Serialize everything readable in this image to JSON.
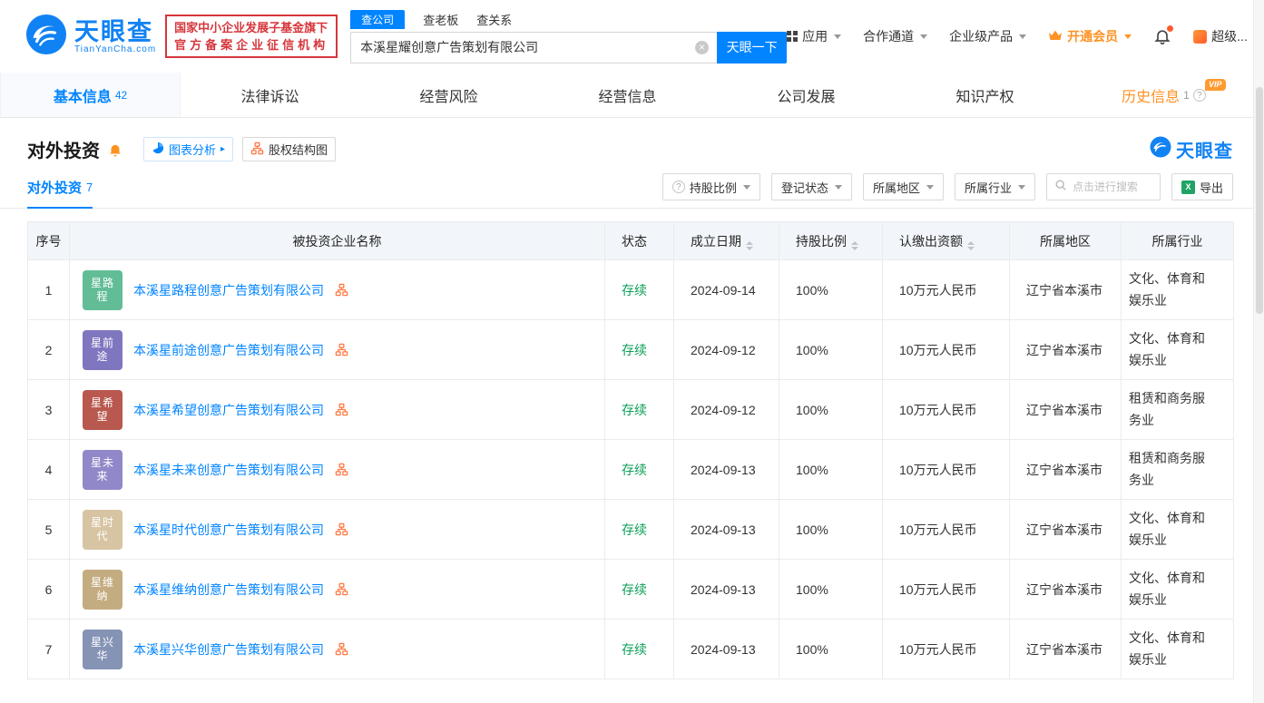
{
  "brand": {
    "name": "天眼查",
    "domain": "TianYanCha.com",
    "slogan_line1": "国家中小企业发展子基金旗下",
    "slogan_line2": "官方备案企业征信机构"
  },
  "search": {
    "tabs": [
      {
        "label": "查公司",
        "active": true
      },
      {
        "label": "查老板",
        "active": false
      },
      {
        "label": "查关系",
        "active": false
      }
    ],
    "value": "本溪星耀创意广告策划有限公司",
    "button_label": "天眼一下"
  },
  "top_menu": {
    "apps": "应用",
    "cooperation": "合作通道",
    "enterprise": "企业级产品",
    "vip": "开通会员",
    "super": "超级..."
  },
  "nav_tabs": [
    {
      "label": "基本信息",
      "count": "42"
    },
    {
      "label": "法律诉讼"
    },
    {
      "label": "经营风险"
    },
    {
      "label": "经营信息"
    },
    {
      "label": "公司发展"
    },
    {
      "label": "知识产权"
    },
    {
      "label": "历史信息",
      "count": "1",
      "badge": "VIP"
    }
  ],
  "section": {
    "title": "对外投资",
    "chart_analysis": "图表分析",
    "equity_chart": "股权结构图",
    "subtab_label": "对外投资",
    "subtab_count": "7",
    "watermark": "天眼查"
  },
  "filters": {
    "holding_ratio": "持股比例",
    "reg_status": "登记状态",
    "region": "所属地区",
    "industry": "所属行业",
    "search_placeholder": "点击进行搜索",
    "export_label": "导出"
  },
  "table": {
    "headers": [
      "序号",
      "被投资企业名称",
      "状态",
      "成立日期",
      "持股比例",
      "认缴出资额",
      "所属地区",
      "所属行业"
    ],
    "rows": [
      {
        "no": "1",
        "avatar_text": "星路程",
        "avatar_color": "#62bd96",
        "name": "本溪星路程创意广告策划有限公司",
        "status": "存续",
        "date": "2024-09-14",
        "ratio": "100%",
        "amount": "10万元人民币",
        "region": "辽宁省本溪市",
        "industry": "文化、体育和娱乐业"
      },
      {
        "no": "2",
        "avatar_text": "星前途",
        "avatar_color": "#7f76c0",
        "name": "本溪星前途创意广告策划有限公司",
        "status": "存续",
        "date": "2024-09-12",
        "ratio": "100%",
        "amount": "10万元人民币",
        "region": "辽宁省本溪市",
        "industry": "文化、体育和娱乐业"
      },
      {
        "no": "3",
        "avatar_text": "星希望",
        "avatar_color": "#b8584e",
        "name": "本溪星希望创意广告策划有限公司",
        "status": "存续",
        "date": "2024-09-12",
        "ratio": "100%",
        "amount": "10万元人民币",
        "region": "辽宁省本溪市",
        "industry": "租赁和商务服务业"
      },
      {
        "no": "4",
        "avatar_text": "星未来",
        "avatar_color": "#9188c9",
        "name": "本溪星未来创意广告策划有限公司",
        "status": "存续",
        "date": "2024-09-13",
        "ratio": "100%",
        "amount": "10万元人民币",
        "region": "辽宁省本溪市",
        "industry": "租赁和商务服务业"
      },
      {
        "no": "5",
        "avatar_text": "星时代",
        "avatar_color": "#d7c4a3",
        "name": "本溪星时代创意广告策划有限公司",
        "status": "存续",
        "date": "2024-09-13",
        "ratio": "100%",
        "amount": "10万元人民币",
        "region": "辽宁省本溪市",
        "industry": "文化、体育和娱乐业"
      },
      {
        "no": "6",
        "avatar_text": "星维纳",
        "avatar_color": "#c4ac81",
        "name": "本溪星维纳创意广告策划有限公司",
        "status": "存续",
        "date": "2024-09-13",
        "ratio": "100%",
        "amount": "10万元人民币",
        "region": "辽宁省本溪市",
        "industry": "文化、体育和娱乐业"
      },
      {
        "no": "7",
        "avatar_text": "星兴华",
        "avatar_color": "#8593b5",
        "name": "本溪星兴华创意广告策划有限公司",
        "status": "存续",
        "date": "2024-09-13",
        "ratio": "100%",
        "amount": "10万元人民币",
        "region": "辽宁省本溪市",
        "industry": "文化、体育和娱乐业"
      }
    ]
  },
  "colors": {
    "brand_blue": "#0084ff",
    "status_green": "#0b9e57",
    "accent_orange": "#ff7a45",
    "vip_orange": "#ff9224"
  }
}
